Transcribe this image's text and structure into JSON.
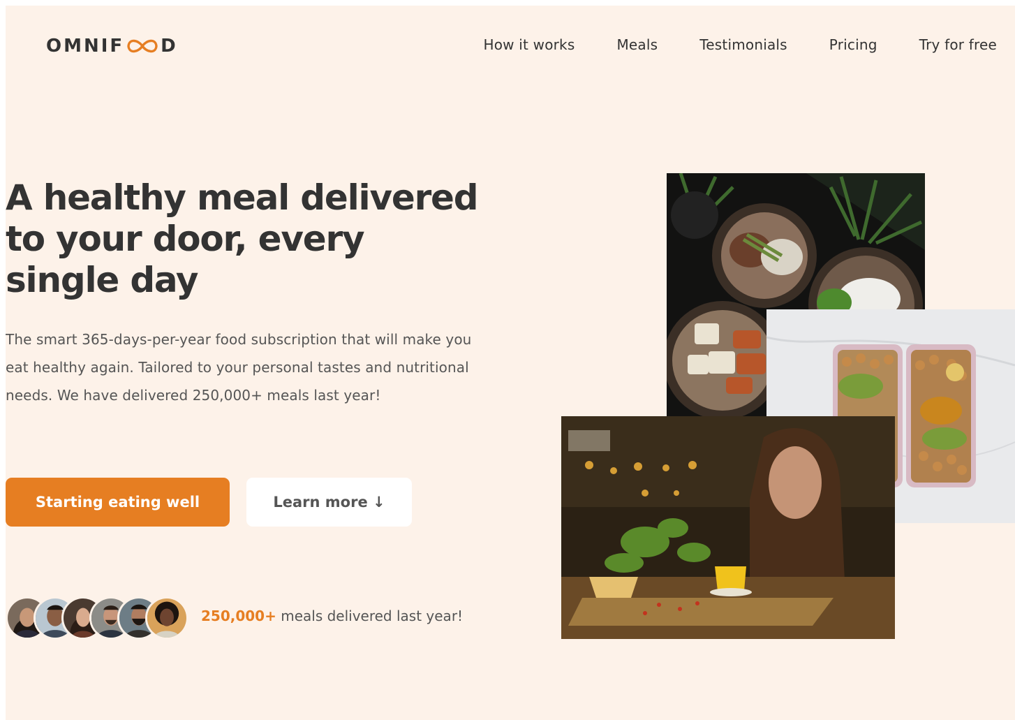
{
  "header": {
    "logo_text_left": "OMNIF",
    "logo_text_right": "D",
    "nav_items": [
      {
        "label": "How it works"
      },
      {
        "label": "Meals"
      },
      {
        "label": "Testimonials"
      },
      {
        "label": "Pricing"
      },
      {
        "label": "Try for free"
      }
    ]
  },
  "hero": {
    "title": "A healthy meal delivered to your door, every single day",
    "description": "The smart 365-days-per-year food subscription that will make you eat healthy again. Tailored to your personal tastes and nutritional needs. We have delivered 250,000+ meals last year!",
    "primary_button": "Starting eating well",
    "secondary_button": "Learn more ↓",
    "delivered_count": "250,000+",
    "delivered_text": " meals delivered last year!"
  },
  "images": {
    "hero_photos": [
      "food bowls",
      "meal prep boxes",
      "woman enjoying meal"
    ],
    "customer_avatars": 6
  },
  "colors": {
    "accent": "#e67e22",
    "background": "#fdf2e9",
    "text": "#333333",
    "secondary_text": "#555555"
  }
}
